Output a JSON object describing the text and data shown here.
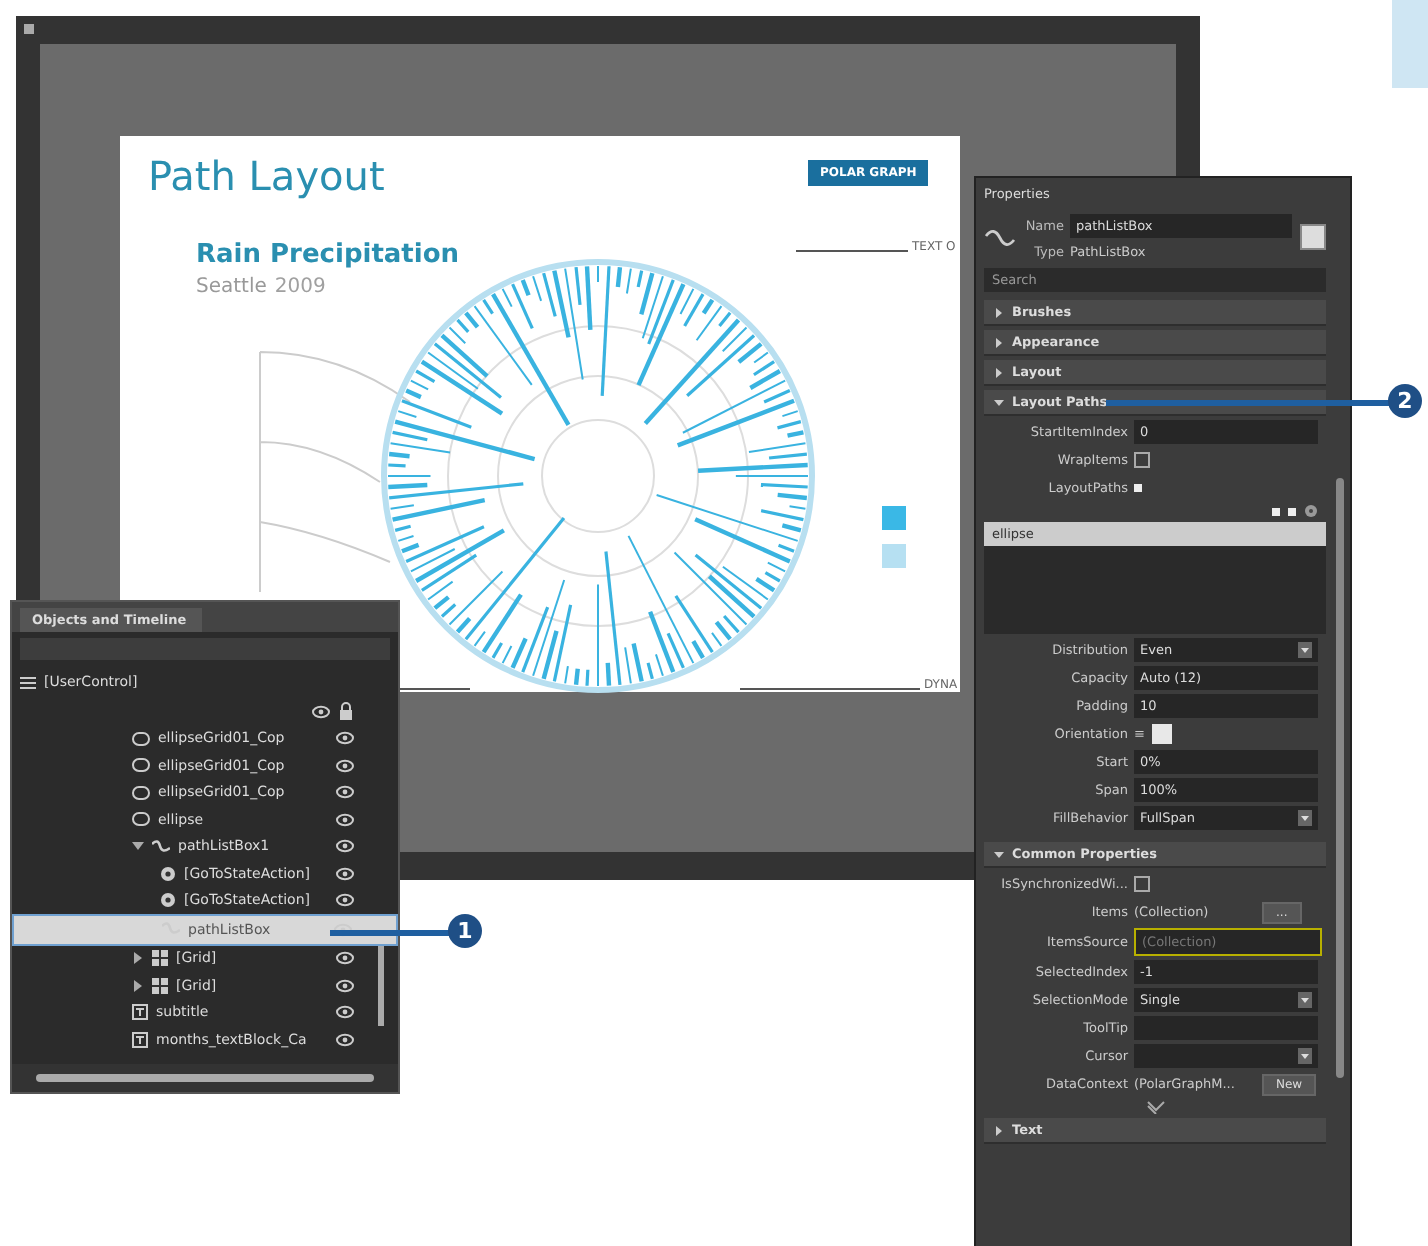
{
  "designer": {
    "title": "Path Layout",
    "button": "POLAR GRAPH",
    "chart_title": "Rain Precipitation",
    "city": "Seattle",
    "year": "2009",
    "callouts": [
      "TEXT O",
      "DYNA"
    ]
  },
  "objects_panel": {
    "title": "Objects and Timeline",
    "root": "[UserControl]",
    "items": [
      {
        "label": "ellipseGrid01_Cop",
        "kind": "ellipse",
        "selected": false
      },
      {
        "label": "ellipseGrid01_Cop",
        "kind": "ellipse",
        "selected": false
      },
      {
        "label": "ellipseGrid01_Cop",
        "kind": "ellipse",
        "selected": false
      },
      {
        "label": "ellipse",
        "kind": "ellipse",
        "selected": false
      },
      {
        "label": "pathListBox1",
        "kind": "listbox",
        "selected": false,
        "expanded": true,
        "children": [
          {
            "label": "[GoToStateAction]",
            "kind": "action",
            "selected": false
          },
          {
            "label": "[GoToStateAction]",
            "kind": "action",
            "selected": false
          },
          {
            "label": "pathListBox",
            "kind": "listbox",
            "selected": true
          }
        ]
      },
      {
        "label": "[Grid]",
        "kind": "grid",
        "selected": false,
        "expanded": false
      },
      {
        "label": "[Grid]",
        "kind": "grid",
        "selected": false,
        "expanded": false
      },
      {
        "label": "subtitle",
        "kind": "text",
        "selected": false
      },
      {
        "label": "months_textBlock_Ca",
        "kind": "text",
        "selected": false
      }
    ]
  },
  "properties": {
    "title": "Properties",
    "name_label": "Name",
    "name_value": "pathListBox",
    "type_label": "Type",
    "type_value": "PathListBox",
    "search_placeholder": "Search",
    "categories": [
      {
        "label": "Brushes",
        "expanded": false
      },
      {
        "label": "Appearance",
        "expanded": false
      },
      {
        "label": "Layout",
        "expanded": false
      },
      {
        "label": "Layout Paths",
        "expanded": true
      }
    ],
    "path_rows": [
      {
        "label": "StartItemIndex",
        "kind": "field",
        "value": "0"
      },
      {
        "label": "WrapItems",
        "kind": "checkbox",
        "checked": false
      },
      {
        "label": "LayoutPaths",
        "kind": "marker"
      }
    ],
    "paths_list": [
      {
        "label": "ellipse",
        "selected": true
      }
    ],
    "path_settings": [
      {
        "label": "Distribution",
        "kind": "dropdown",
        "value": "Even"
      },
      {
        "label": "Capacity",
        "kind": "field",
        "value": "Auto (12)"
      },
      {
        "label": "Padding",
        "kind": "field",
        "value": "10"
      },
      {
        "label": "Orientation",
        "kind": "toggle",
        "value": "≡"
      },
      {
        "label": "Start",
        "kind": "field",
        "value": "0%"
      },
      {
        "label": "Span",
        "kind": "field",
        "value": "100%"
      },
      {
        "label": "FillBehavior",
        "kind": "dropdown",
        "value": "FullSpan"
      }
    ],
    "common_title": "Common Properties",
    "common_rows": [
      {
        "label": "IsSynchronizedWi...",
        "kind": "checkbox",
        "checked": false
      },
      {
        "label": "Items",
        "kind": "collection",
        "value": "(Collection)",
        "button": "..."
      },
      {
        "label": "ItemsSource",
        "kind": "placeholder",
        "placeholder": "(Collection)"
      },
      {
        "label": "SelectedIndex",
        "kind": "field",
        "value": "-1"
      },
      {
        "label": "SelectionMode",
        "kind": "dropdown",
        "value": "Single"
      },
      {
        "label": "ToolTip",
        "kind": "field",
        "value": ""
      },
      {
        "label": "Cursor",
        "kind": "dropdown",
        "value": ""
      },
      {
        "label": "DataContext",
        "kind": "collection",
        "value": "(PolarGraphM...",
        "button": "New"
      }
    ],
    "last_category": {
      "label": "Text",
      "expanded": false
    }
  },
  "callouts": [
    {
      "number": "1"
    },
    {
      "number": "2"
    }
  ]
}
